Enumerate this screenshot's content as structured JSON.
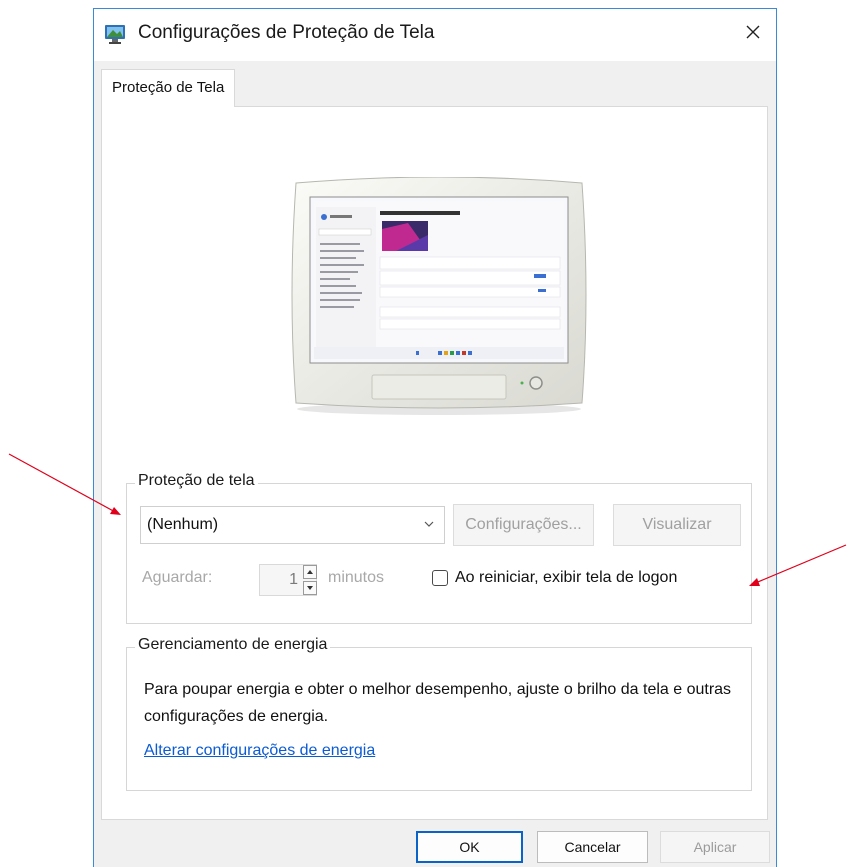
{
  "window": {
    "title": "Configurações de Proteção de Tela",
    "close_glyph": "✕",
    "icon": "screensaver-monitor-icon"
  },
  "tabs": [
    {
      "label": "Proteção de Tela",
      "selected": true
    }
  ],
  "screensaver_group": {
    "legend": "Proteção de tela",
    "select_value": "(Nenhum)",
    "settings_button": "Configurações...",
    "preview_button": "Visualizar",
    "wait_label": "Aguardar:",
    "wait_value": "1",
    "minutes_label": "minutos",
    "logon_checkbox_label": "Ao reiniciar, exibir tela de logon",
    "logon_checked": false
  },
  "energy_group": {
    "legend": "Gerenciamento de energia",
    "description": "Para poupar energia e obter o melhor desempenho, ajuste o brilho da tela e outras configurações de energia.",
    "link": "Alterar configurações de energia"
  },
  "buttons": {
    "ok": "OK",
    "cancel": "Cancelar",
    "apply": "Aplicar"
  },
  "colors": {
    "accent": "#0a64c8",
    "window_border": "#3c8ad6",
    "link": "#0b5bd3",
    "annotation_arrow": "#e0001b"
  }
}
